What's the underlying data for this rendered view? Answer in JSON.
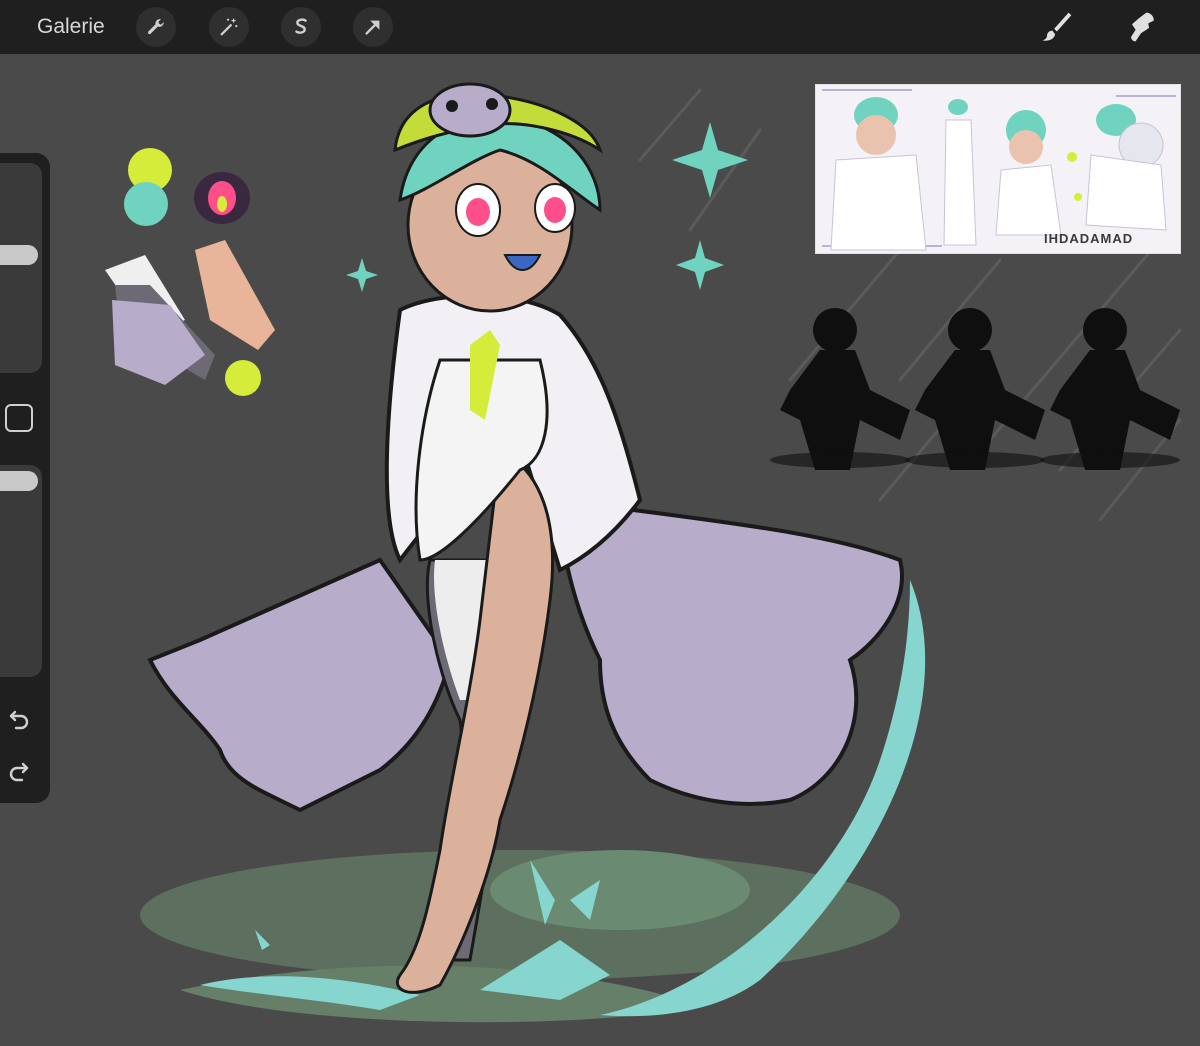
{
  "toolbar": {
    "gallery_label": "Galerie",
    "tools": [
      {
        "icon": "wrench-icon"
      },
      {
        "icon": "magic-wand-icon"
      },
      {
        "icon": "selection-s-icon"
      },
      {
        "icon": "transform-arrow-icon"
      }
    ],
    "right_tools": [
      {
        "icon": "brush-icon"
      },
      {
        "icon": "smudge-icon"
      }
    ]
  },
  "sidebar": {
    "size_slider_level": 0.55,
    "opacity_slider_level": 0.08,
    "modify_button_icon": "square-icon",
    "undo_icon": "undo-icon",
    "redo_icon": "redo-icon"
  },
  "reference_sheet": {
    "logo_text": "IHDADAMAD"
  },
  "colors": {
    "topbar": "#1f1f1f",
    "canvas": "#4a4a4a",
    "palette": [
      "#d6ec3a",
      "#6fd3c0",
      "#ff4f8a",
      "#e9e9e9",
      "#b7acc9",
      "#e8b59a",
      "#6d6a76"
    ]
  }
}
